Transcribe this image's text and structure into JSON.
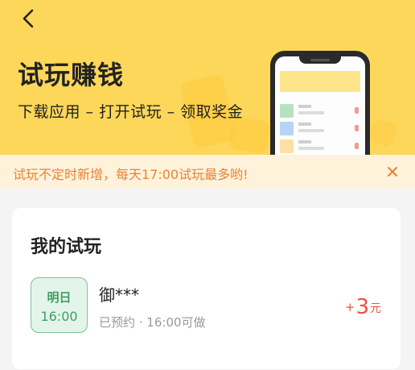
{
  "header": {
    "title": "试玩赚钱",
    "subtitle": "下载应用 – 打开试玩 – 领取奖金"
  },
  "notice": {
    "text": "试玩不定时新增，每天17:00试玩最多哟!"
  },
  "my_trials": {
    "title": "我的试玩",
    "items": [
      {
        "date_label": "明日",
        "time_label": "16:00",
        "name": "御***",
        "status": "已预约 · 16:00可做",
        "reward_sign": "+",
        "reward_amount": "3",
        "reward_unit": "元"
      }
    ]
  },
  "colors": {
    "header_bg": "#fcd75a",
    "notice_bg": "#fef3da",
    "notice_text": "#e8823a",
    "badge_green": "#3f9f62",
    "reward_red": "#ee5142"
  },
  "icons": {
    "back": "chevron-left-icon",
    "close": "close-icon"
  }
}
